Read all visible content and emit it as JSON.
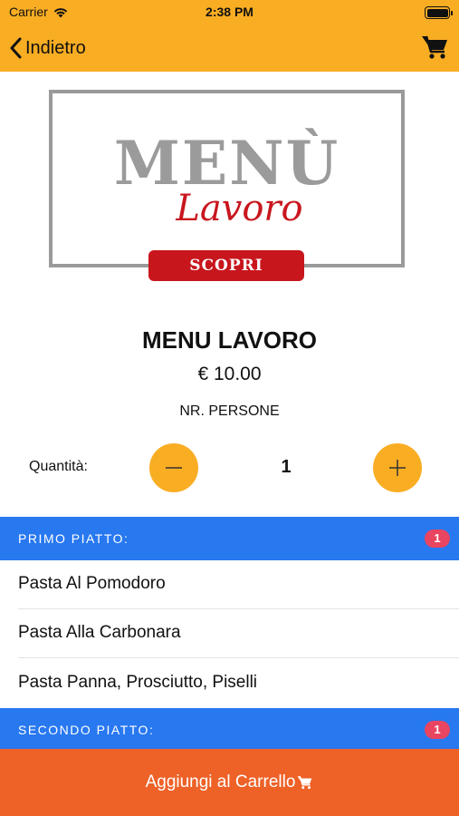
{
  "status_bar": {
    "carrier": "Carrier",
    "time": "2:38 PM"
  },
  "nav": {
    "back_label": "Indietro",
    "cart_icon": "cart-icon"
  },
  "banner": {
    "title_big": "MENÙ",
    "title_script": "Lavoro",
    "button_label": "SCOPRI",
    "frame_color": "#9a9a9a",
    "accent_color": "#c8161d"
  },
  "product": {
    "title": "MENU LAVORO",
    "price": "€ 10.00",
    "persons_label": "NR. PERSONE"
  },
  "quantity": {
    "label": "Quantità:",
    "value": "1"
  },
  "sections": [
    {
      "title": "PRIMO PIATTO:",
      "badge": "1",
      "items": [
        "Pasta Al Pomodoro",
        "Pasta Alla Carbonara",
        "Pasta Panna, Prosciutto, Piselli"
      ]
    },
    {
      "title": "SECONDO PIATTO:",
      "badge": "1",
      "items": []
    }
  ],
  "footer": {
    "add_to_cart_label": "Aggiungi al Carrello"
  },
  "colors": {
    "primary": "#F9AD23",
    "section": "#2878F0",
    "badge": "#E94560",
    "cta": "#EE6127"
  }
}
